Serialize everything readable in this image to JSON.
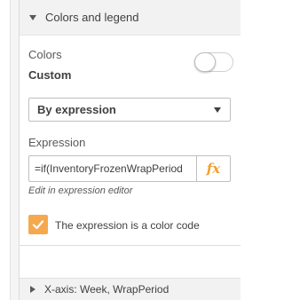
{
  "section": {
    "title": "Colors and legend",
    "colors_label": "Colors",
    "mode_label": "Custom",
    "toggle_on": false,
    "dropdown_value": "By expression",
    "expression_label": "Expression",
    "expression_value": "=if(InventoryFrozenWrapPeriod",
    "fx_label": "fx",
    "edit_link": "Edit in expression editor",
    "checkbox_label": "The expression is a color code",
    "checkbox_checked": true
  },
  "next_section": {
    "title": "X-axis: Week, WrapPeriod"
  },
  "colors": {
    "accent": "#f5a94f",
    "fx": "#f0a030",
    "header_bg": "#f2f2f2"
  },
  "icons": {
    "expand": "caret-down-icon",
    "collapse": "caret-right-icon",
    "dropdown": "chevron-down-icon",
    "function": "fx-icon",
    "check": "check-icon"
  }
}
